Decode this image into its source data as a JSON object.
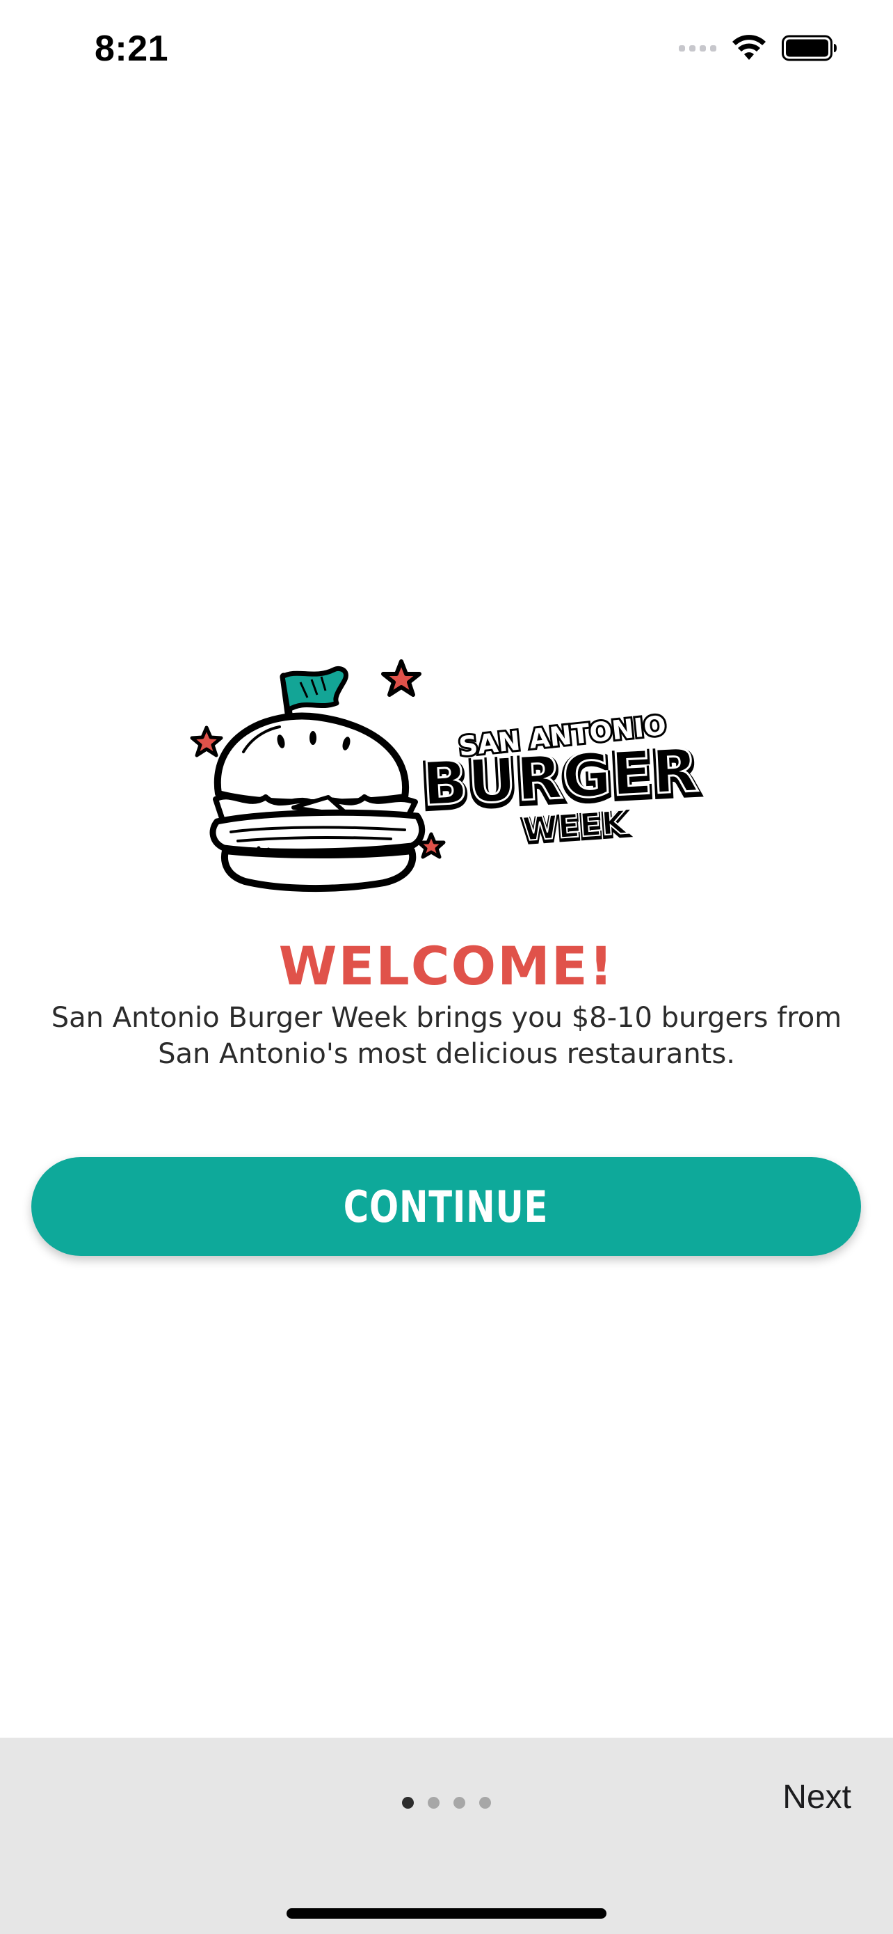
{
  "status_bar": {
    "time": "8:21"
  },
  "logo": {
    "line1": "SAN ANTONIO",
    "line2": "BURGER",
    "line3": "WEEK"
  },
  "welcome": {
    "title": "WELCOME!",
    "body": "San Antonio Burger Week brings you $8-10 burgers from San Antonio's most delicious restaurants."
  },
  "continue_button": {
    "label": "CONTINUE"
  },
  "pager": {
    "total_pages": 4,
    "current_page": 1
  },
  "next_button": {
    "label": "Next"
  },
  "colors": {
    "accent_teal": "#0ea99a",
    "welcome_red": "#e0524a",
    "star_red": "#e0524a",
    "bottom_bar": "#e6e6e6"
  },
  "icons": {
    "signal": "cellular-signal-icon",
    "wifi": "wifi-icon",
    "battery": "battery-icon",
    "logo_burger": "burger-icon",
    "logo_flag": "flag-icon",
    "logo_star": "star-icon"
  }
}
